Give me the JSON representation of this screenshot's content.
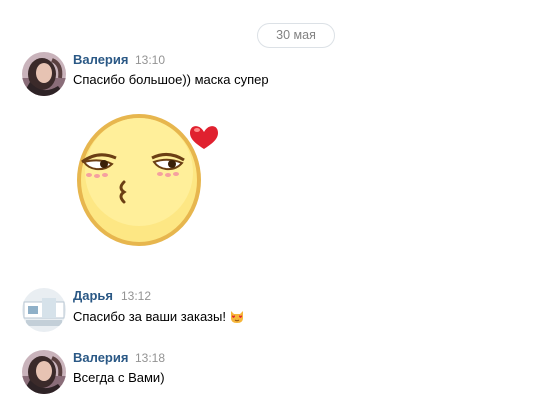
{
  "date_separator": "30 мая",
  "messages": [
    {
      "author": "Валерия",
      "time": "13:10",
      "text": "Спасибо большое)) маска супер",
      "sticker": "kissing-smiley-with-heart-sticker"
    },
    {
      "author": "Дарья",
      "time": "13:12",
      "text": "Спасибо за ваши заказы!",
      "emoji": "heart-eyes-cat-emoji"
    },
    {
      "author": "Валерия",
      "time": "13:18",
      "text": "Всегда с Вами)"
    }
  ],
  "colors": {
    "author_link": "#2a5885",
    "time_gray": "#939393",
    "date_pill_border": "#dce1e6"
  }
}
